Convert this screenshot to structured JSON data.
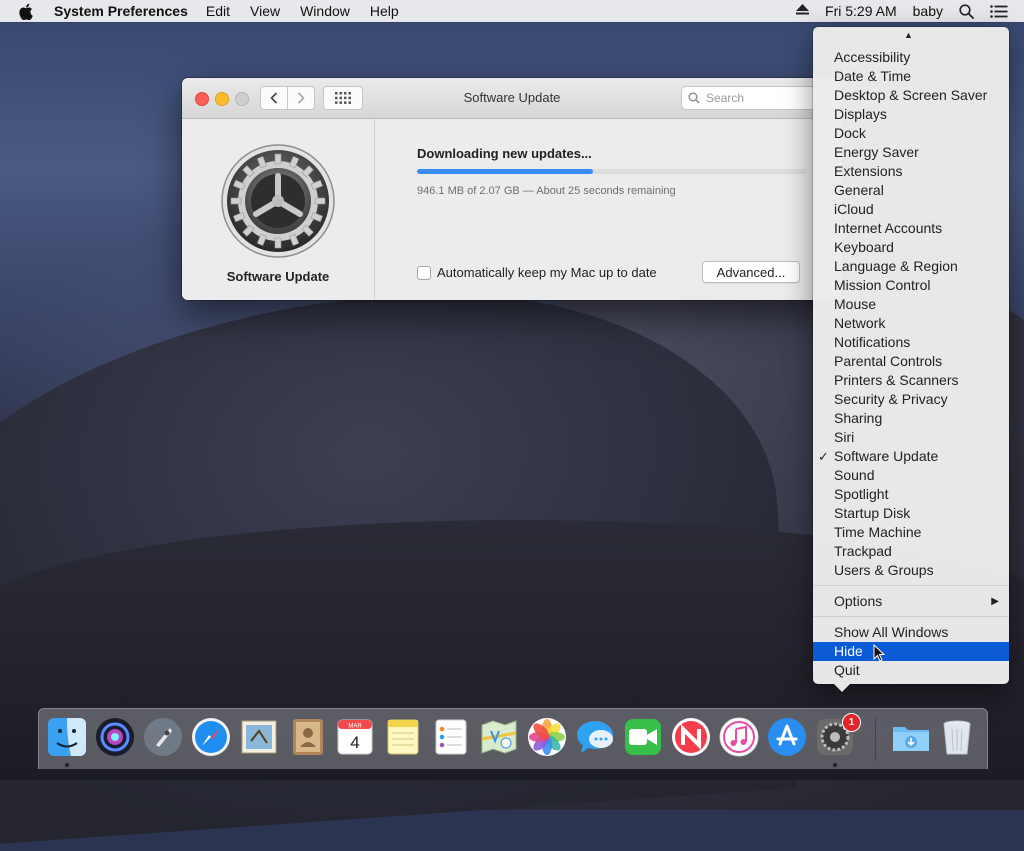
{
  "menubar": {
    "app_name": "System Preferences",
    "menus": [
      "Edit",
      "View",
      "Window",
      "Help"
    ],
    "clock": "Fri 5:29 AM",
    "user": "baby"
  },
  "window": {
    "title": "Software Update",
    "search_placeholder": "Search",
    "sidebar_label": "Software Update",
    "download_title": "Downloading new updates...",
    "download_progress": 0.45,
    "download_status": "946.1 MB of 2.07 GB — About 25 seconds remaining",
    "auto_update_label": "Automatically keep my Mac up to date",
    "advanced_button": "Advanced..."
  },
  "dock_menu": {
    "items": [
      "Accessibility",
      "Date & Time",
      "Desktop & Screen Saver",
      "Displays",
      "Dock",
      "Energy Saver",
      "Extensions",
      "General",
      "iCloud",
      "Internet Accounts",
      "Keyboard",
      "Language & Region",
      "Mission Control",
      "Mouse",
      "Network",
      "Notifications",
      "Parental Controls",
      "Printers & Scanners",
      "Security & Privacy",
      "Sharing",
      "Siri",
      "Software Update",
      "Sound",
      "Spotlight",
      "Startup Disk",
      "Time Machine",
      "Trackpad",
      "Users & Groups"
    ],
    "checked_item": "Software Update",
    "options": "Options",
    "show_all_windows": "Show All Windows",
    "hide": "Hide",
    "quit": "Quit"
  },
  "dock": {
    "apps": [
      "finder-icon",
      "siri-icon",
      "launchpad-icon",
      "safari-icon",
      "mail-icon",
      "contacts-icon",
      "calendar-icon",
      "notes-icon",
      "reminders-icon",
      "maps-icon",
      "photos-icon",
      "messages-icon",
      "facetime-icon",
      "news-icon",
      "itunes-icon",
      "app-store-icon",
      "system-preferences-icon",
      "downloads-icon",
      "trash-icon"
    ],
    "calendar_month": "MAR",
    "calendar_day": "4",
    "system_preferences_badge": "1"
  },
  "colors": {
    "accent": "#3b8bf5",
    "menu_highlight": "#0b5bd6",
    "badge": "#e0262a"
  }
}
